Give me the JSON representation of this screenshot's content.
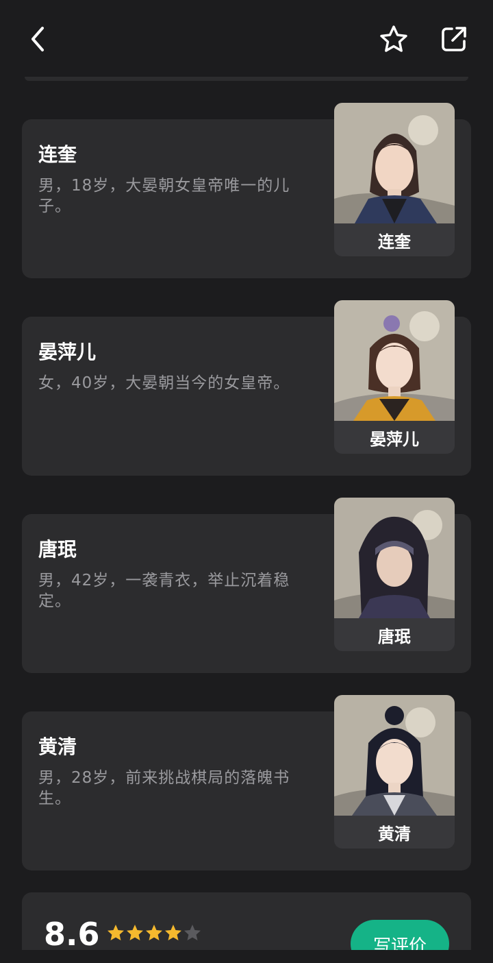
{
  "header": {
    "back_icon": "chevron-left-icon",
    "favorite_icon": "star-outline-icon",
    "share_icon": "external-link-icon"
  },
  "characters": [
    {
      "name": "连奎",
      "description": "男，18岁，大晏朝女皇帝唯一的儿子。",
      "portrait_label": "连奎"
    },
    {
      "name": "晏萍儿",
      "description": "女，40岁，大晏朝当今的女皇帝。",
      "portrait_label": "晏萍儿"
    },
    {
      "name": "唐珉",
      "description": "男，42岁，一袭青衣，举止沉着稳定。",
      "portrait_label": "唐珉"
    },
    {
      "name": "黄清",
      "description": "男，28岁，前来挑战棋局的落魄书生。",
      "portrait_label": "黄清"
    }
  ],
  "rating": {
    "score": "8.6",
    "stars_filled": 4,
    "stars_total": 5,
    "write_review_label": "写评价"
  },
  "colors": {
    "background": "#1c1c1e",
    "card": "#2c2c2e",
    "accent_green": "#15b387",
    "star_gold": "#f5b92e",
    "star_empty": "#5a5a5e"
  }
}
